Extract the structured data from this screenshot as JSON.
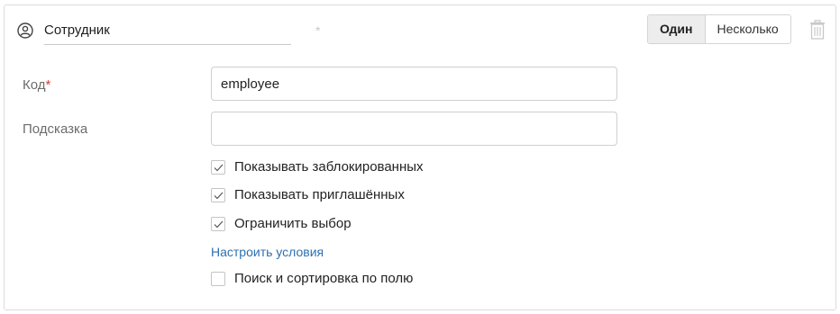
{
  "header": {
    "icon": "user-circle-icon",
    "field_name": "Сотрудник",
    "required_mark": "*",
    "mode_options": [
      "Один",
      "Несколько"
    ],
    "mode_selected": "Один",
    "delete_icon": "trash-icon"
  },
  "form": {
    "code": {
      "label": "Код",
      "required_mark": "*",
      "value": "employee"
    },
    "hint": {
      "label": "Подсказка",
      "value": ""
    },
    "options": [
      {
        "label": "Показывать заблокированных",
        "checked": true
      },
      {
        "label": "Показывать приглашённых",
        "checked": true
      },
      {
        "label": "Ограничить выбор",
        "checked": true
      }
    ],
    "configure_link": "Настроить условия",
    "search_option": {
      "label": "Поиск и сортировка по полю",
      "checked": false
    }
  },
  "colors": {
    "accent_link": "#2f6fb0",
    "required": "#d63b3b",
    "border": "#dcdcdc"
  }
}
